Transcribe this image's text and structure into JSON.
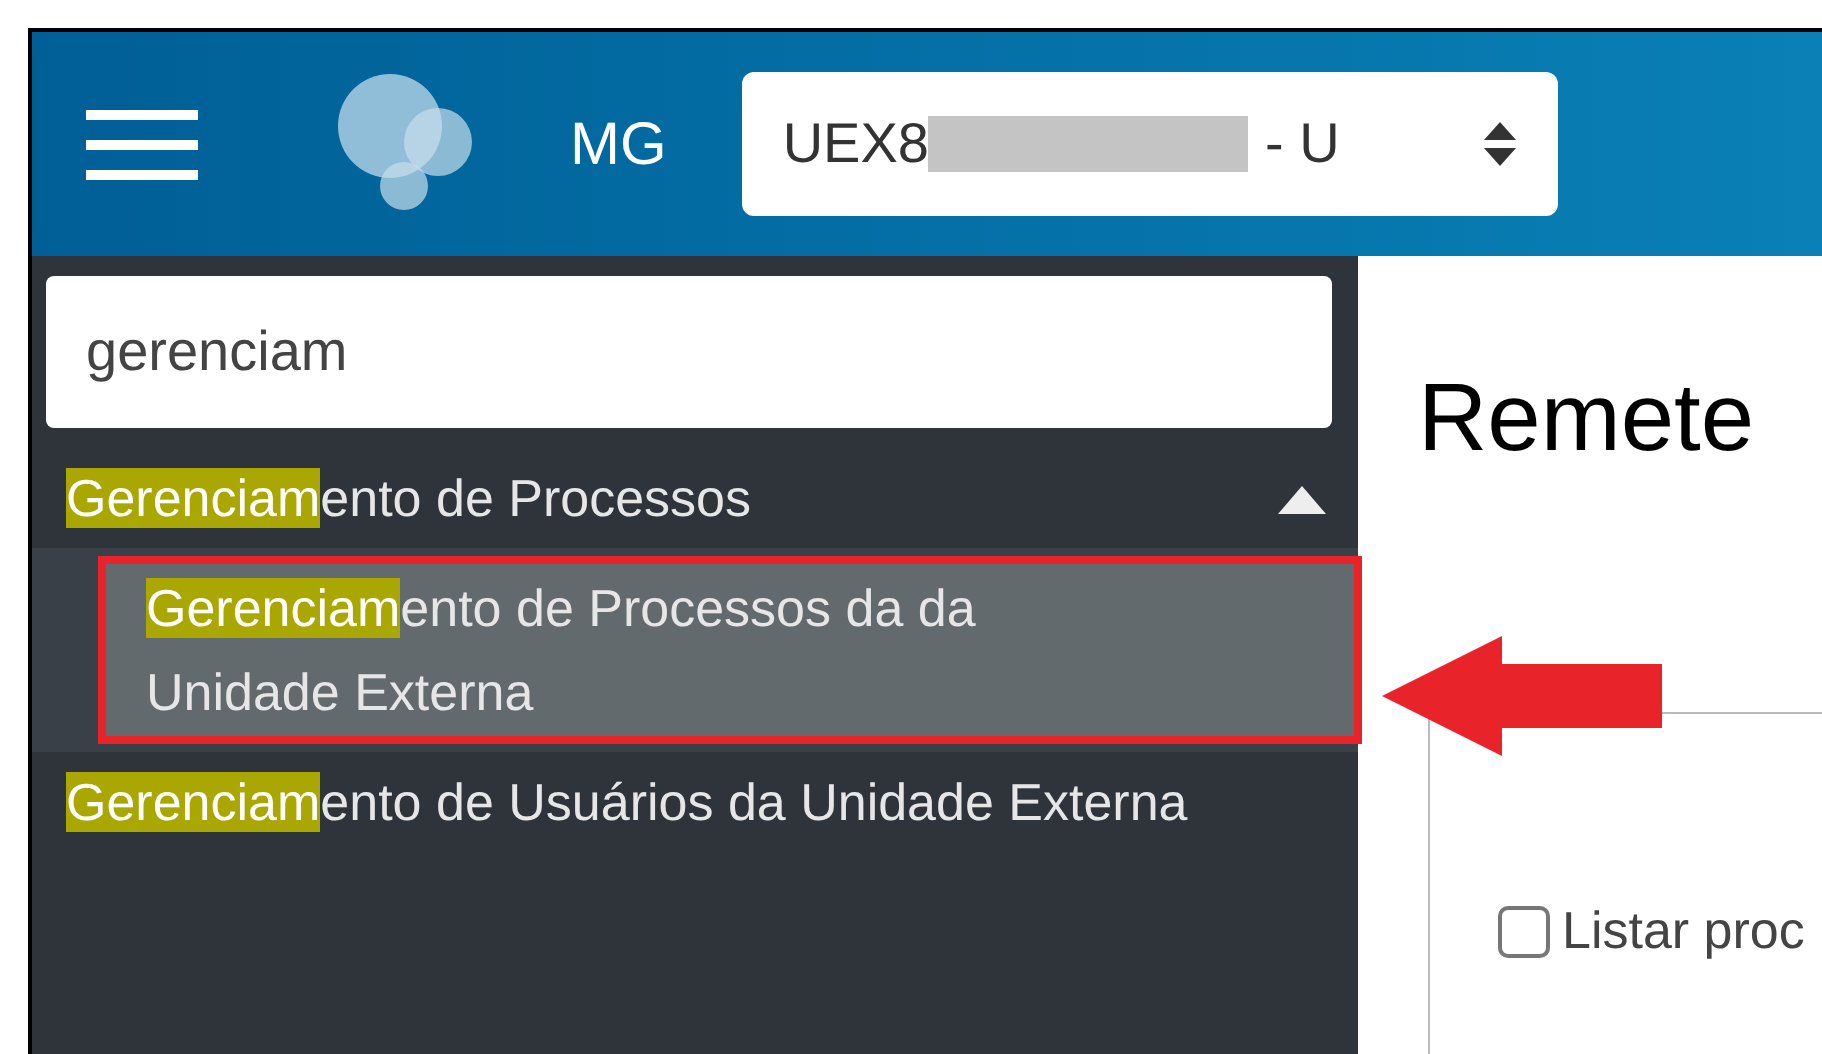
{
  "header": {
    "org": "MG",
    "unit_selector": {
      "value_start": "UEX8",
      "value_end": "- U",
      "redacted": true
    }
  },
  "sidebar": {
    "search": {
      "value": "gerenciam"
    },
    "items": [
      {
        "match": "Gerenciam",
        "rest": "ento de Processos",
        "expanded": true,
        "children": [
          {
            "match": "Gerenciam",
            "rest": "ento de Processos da da Unidade Externa",
            "selected": true
          }
        ]
      },
      {
        "match": "Gerenciam",
        "rest": "ento de Usuários da Unidade Externa",
        "selected": false
      }
    ]
  },
  "main": {
    "title": "Remete",
    "checkbox": {
      "label": "Listar proc",
      "checked": false
    }
  },
  "annotation": {
    "highlight_box": true,
    "arrow": true
  }
}
